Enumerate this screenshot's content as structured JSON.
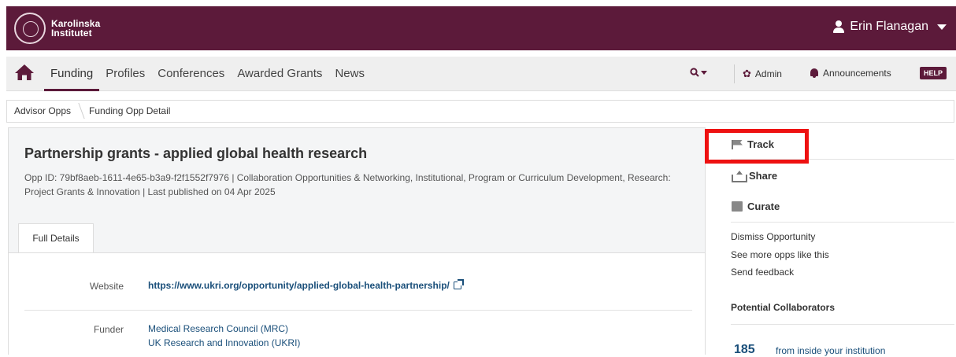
{
  "header": {
    "logo_line1": "Karolinska",
    "logo_line2": "Institutet",
    "user_name": "Erin Flanagan"
  },
  "nav": {
    "items": [
      {
        "label": "Funding",
        "active": true
      },
      {
        "label": "Profiles",
        "active": false
      },
      {
        "label": "Conferences",
        "active": false
      },
      {
        "label": "Awarded Grants",
        "active": false
      },
      {
        "label": "News",
        "active": false
      }
    ],
    "admin_label": "Admin",
    "announcements_label": "Announcements",
    "help_label": "HELP"
  },
  "breadcrumb": {
    "items": [
      "Advisor Opps",
      "Funding Opp Detail"
    ]
  },
  "opportunity": {
    "title": "Partnership grants - applied global health research",
    "meta": "Opp ID: 79bf8aeb-1611-4e65-b3a9-f2f1552f7976  |  Collaboration Opportunities & Networking, Institutional, Program or Curriculum Development, Research: Project Grants & Innovation  |  Last published on 04 Apr 2025",
    "tab_label": "Full Details",
    "website_label": "Website",
    "website_url": "https://www.ukri.org/opportunity/applied-global-health-partnership/",
    "funder_label": "Funder",
    "funders": [
      "Medical Research Council (MRC)",
      "UK Research and Innovation (UKRI)"
    ]
  },
  "sidebar": {
    "track_label": "Track",
    "share_label": "Share",
    "curate_label": "Curate",
    "links": [
      "Dismiss Opportunity",
      "See more opps like this",
      "Send feedback"
    ],
    "collaborators_heading": "Potential Collaborators",
    "collaborators_count": "185",
    "collaborators_text": "from inside your institution"
  },
  "colors": {
    "brand": "#5c1a3a",
    "link": "#1a4f7a",
    "highlight": "#ee1111"
  }
}
